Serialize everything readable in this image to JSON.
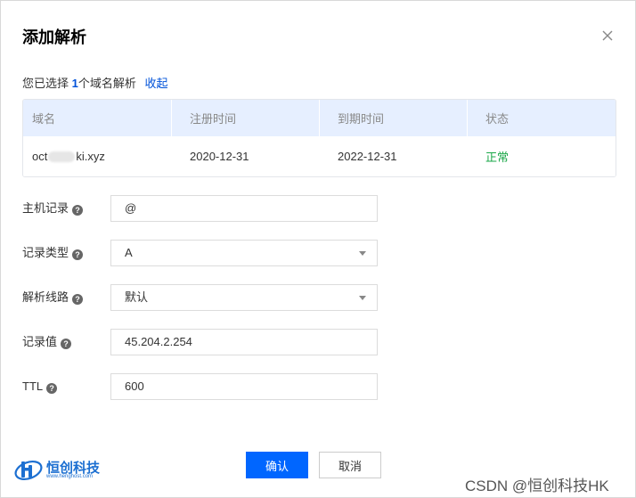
{
  "dialog": {
    "title": "添加解析",
    "close_icon": "close-icon"
  },
  "selection": {
    "prefix": "您已选择",
    "count": "1",
    "suffix": "个域名解析",
    "collapse_label": "收起"
  },
  "table": {
    "headers": [
      "域名",
      "注册时间",
      "到期时间",
      "状态"
    ],
    "rows": [
      {
        "domain_start": "oct",
        "domain_end": "ki.xyz",
        "registered": "2020-12-31",
        "expires": "2022-12-31",
        "status": "正常"
      }
    ],
    "status_color": "#1aa748"
  },
  "form": {
    "host_record": {
      "label": "主机记录",
      "value": "@"
    },
    "record_type": {
      "label": "记录类型",
      "value": "A"
    },
    "line": {
      "label": "解析线路",
      "value": "默认"
    },
    "record_value": {
      "label": "记录值",
      "value": "45.204.2.254"
    },
    "ttl": {
      "label": "TTL",
      "value": "600"
    },
    "help_icon": "question-circle-icon"
  },
  "footer": {
    "confirm_label": "确认",
    "cancel_label": "取消"
  },
  "logo": {
    "name": "恒创科技",
    "url": "www.henghost.com"
  },
  "watermark": "CSDN @恒创科技HK",
  "colors": {
    "primary": "#0066ff",
    "link": "#0052d9",
    "table_header_bg": "#e6efff"
  }
}
